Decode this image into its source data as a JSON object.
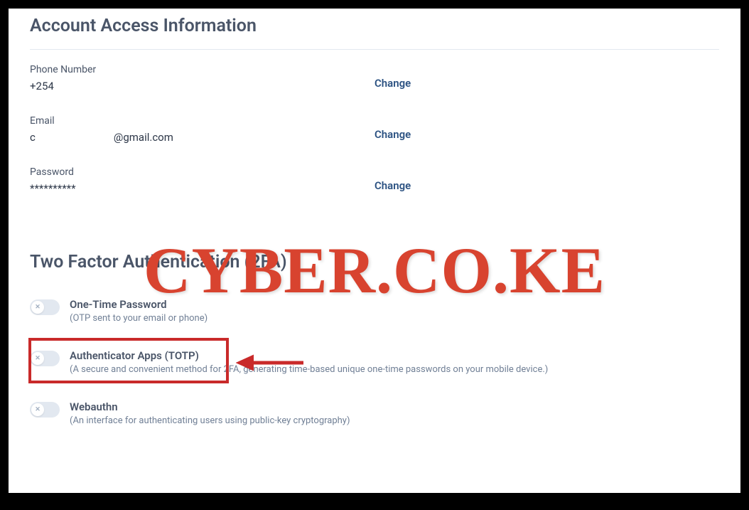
{
  "account_access": {
    "title": "Account Access Information",
    "phone": {
      "label": "Phone Number",
      "prefix": "+254",
      "action": "Change"
    },
    "email": {
      "label": "Email",
      "prefix": "c",
      "suffix": "@gmail.com",
      "action": "Change"
    },
    "password": {
      "label": "Password",
      "value": "**********",
      "action": "Change"
    }
  },
  "tfa": {
    "title": "Two Factor Authentication (2FA)",
    "options": [
      {
        "label": "One-Time Password",
        "desc": "(OTP sent to your email or phone)",
        "enabled": false
      },
      {
        "label": "Authenticator Apps (TOTP)",
        "desc": "(A secure and convenient method for 2FA, generating time-based unique one-time passwords on your mobile device.)",
        "enabled": false
      },
      {
        "label": "Webauthn",
        "desc": "(An interface for authenticating users using public-key cryptography)",
        "enabled": false
      }
    ]
  },
  "watermark": "CYBER.CO.KE",
  "icons": {
    "x": "✕"
  }
}
